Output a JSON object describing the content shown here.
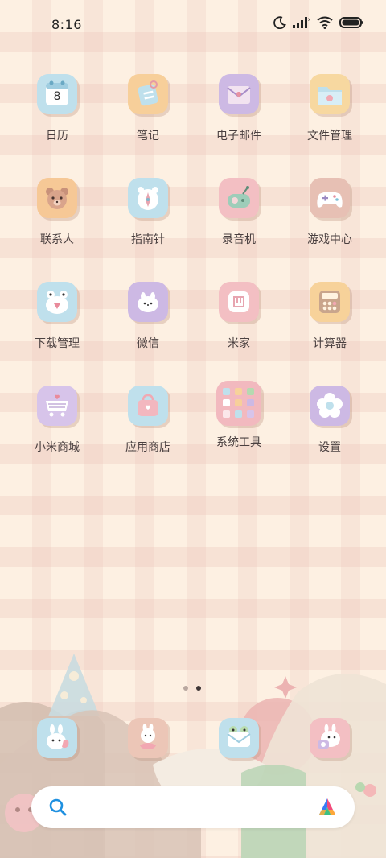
{
  "status": {
    "time": "8:16",
    "icons": [
      "moon-icon",
      "signal-icon",
      "wifi-icon",
      "battery-icon"
    ]
  },
  "apps": [
    {
      "label": "日历",
      "icon": "calendar-icon",
      "bg": "#bfe0ec",
      "badge": "8"
    },
    {
      "label": "笔记",
      "icon": "notes-icon",
      "bg": "#f7cf9a"
    },
    {
      "label": "电子邮件",
      "icon": "email-icon",
      "bg": "#cdb9e4"
    },
    {
      "label": "文件管理",
      "icon": "folder-icon",
      "bg": "#f7d8a0"
    },
    {
      "label": "联系人",
      "icon": "bear-icon",
      "bg": "#f6c896"
    },
    {
      "label": "指南针",
      "icon": "compass-icon",
      "bg": "#bfe0ec"
    },
    {
      "label": "录音机",
      "icon": "recorder-icon",
      "bg": "#f3bfc3"
    },
    {
      "label": "游戏中心",
      "icon": "gamepad-icon",
      "bg": "#e7c0b4"
    },
    {
      "label": "下载管理",
      "icon": "download-frog-icon",
      "bg": "#bfe0ec"
    },
    {
      "label": "微信",
      "icon": "wechat-icon",
      "bg": "#cdb9e4"
    },
    {
      "label": "米家",
      "icon": "mijia-icon",
      "bg": "#f3bfc3"
    },
    {
      "label": "计算器",
      "icon": "calculator-icon",
      "bg": "#f7d29a"
    },
    {
      "label": "小米商城",
      "icon": "cart-icon",
      "bg": "#d7c4ea"
    },
    {
      "label": "应用商店",
      "icon": "store-bag-icon",
      "bg": "#bfe0ec"
    },
    {
      "label": "系统工具",
      "icon": "folder-grid-icon",
      "bg": "#f2b9bf"
    },
    {
      "label": "设置",
      "icon": "settings-flower-icon",
      "bg": "#cdb9e4"
    }
  ],
  "dock": [
    {
      "icon": "bunny-phone-icon",
      "bg": "#bfe0ec"
    },
    {
      "icon": "bunny-contacts-icon",
      "bg": "#ecc6b7"
    },
    {
      "icon": "frog-message-icon",
      "bg": "#bfe0ec"
    },
    {
      "icon": "bunny-camera-icon",
      "bg": "#f3bfc3"
    }
  ],
  "pages": {
    "count": 2,
    "current": 2
  },
  "search": {
    "left_icon": "search-icon",
    "right_icon": "assistant-logo-icon"
  },
  "colors": {
    "accent_blue": "#1e90e0",
    "text": "#4a4040"
  }
}
